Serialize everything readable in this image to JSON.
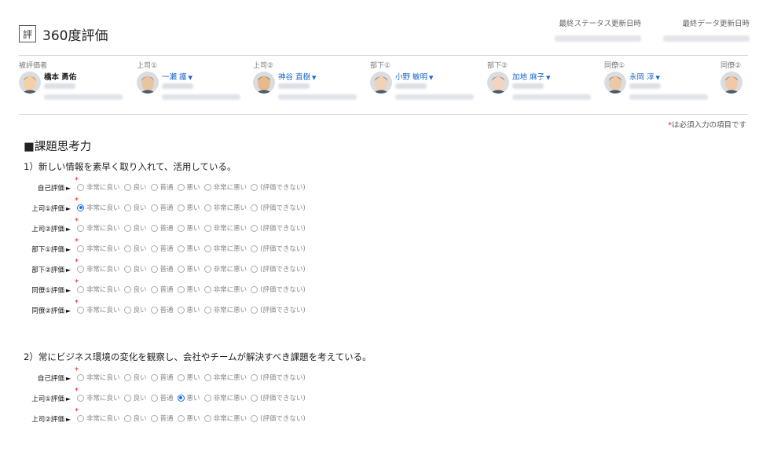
{
  "header": {
    "badge": "評",
    "title": "360度評価"
  },
  "meta": {
    "status_updated_label": "最終ステータス更新日時",
    "data_updated_label": "最終データ更新日時"
  },
  "people": [
    {
      "role": "被評価者",
      "name": "橋本 勇佑",
      "is_link": false
    },
    {
      "role": "上司①",
      "name": "一瀬 護",
      "is_link": true
    },
    {
      "role": "上司②",
      "name": "神谷 直樹",
      "is_link": true
    },
    {
      "role": "部下①",
      "name": "小野 敏明",
      "is_link": true
    },
    {
      "role": "部下②",
      "name": "加地 麻子",
      "is_link": true
    },
    {
      "role": "同僚①",
      "name": "永岡 淳",
      "is_link": true
    },
    {
      "role": "同僚②",
      "name": "",
      "is_link": true
    }
  ],
  "required_note": {
    "star": "*",
    "text": "は必須入力の項目です"
  },
  "section_title": "■課題思考力",
  "options": [
    "非常に良い",
    "良い",
    "普通",
    "悪い",
    "非常に悪い",
    "(評価できない)"
  ],
  "questions": [
    {
      "text": "1）新しい情報を素早く取り入れて、活用している。",
      "rows": [
        {
          "label": "自己評価",
          "selected": null
        },
        {
          "label": "上司①評価",
          "selected": 0
        },
        {
          "label": "上司②評価",
          "selected": null
        },
        {
          "label": "部下①評価",
          "selected": null
        },
        {
          "label": "部下②評価",
          "selected": null
        },
        {
          "label": "同僚①評価",
          "selected": null
        },
        {
          "label": "同僚②評価",
          "selected": null
        }
      ]
    },
    {
      "text": "2）常にビジネス環境の変化を観察し、会社やチームが解決すべき課題を考えている。",
      "rows": [
        {
          "label": "自己評価",
          "selected": null
        },
        {
          "label": "上司①評価",
          "selected": 3
        },
        {
          "label": "上司②評価",
          "selected": null
        }
      ]
    }
  ],
  "arrow_glyph": "►",
  "colors": {
    "link": "#1a66c9",
    "required": "#e02020",
    "radio_selected": "#1a73e8"
  }
}
